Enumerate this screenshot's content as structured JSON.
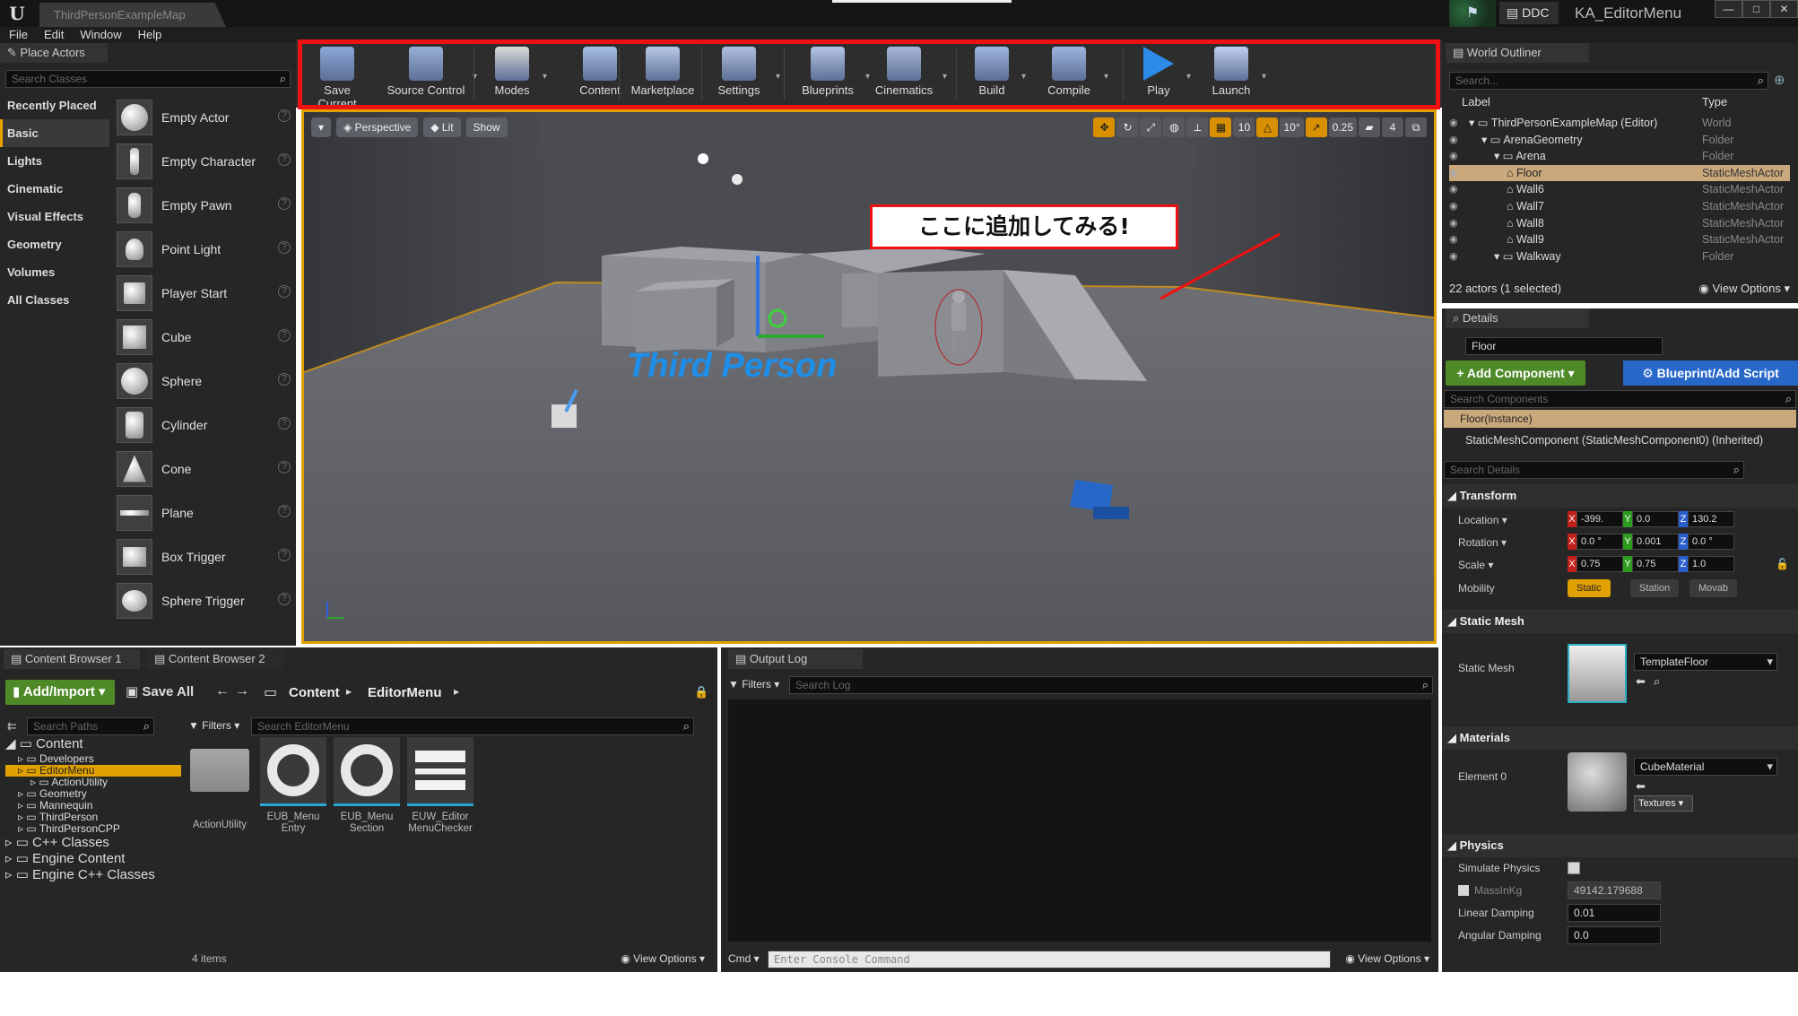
{
  "titlebar": {
    "tab": "ThirdPersonExampleMap",
    "ddc": "DDC",
    "project": "KA_EditorMenu",
    "win_min": "—",
    "win_max": "□",
    "win_close": "✕"
  },
  "menu": [
    "File",
    "Edit",
    "Window",
    "Help"
  ],
  "place_actors": {
    "tab": "Place Actors",
    "search_placeholder": "Search Classes",
    "categories": [
      "Recently Placed",
      "Basic",
      "Lights",
      "Cinematic",
      "Visual Effects",
      "Geometry",
      "Volumes",
      "All Classes"
    ],
    "active_category": "Basic",
    "actors": [
      "Empty Actor",
      "Empty Character",
      "Empty Pawn",
      "Point Light",
      "Player Start",
      "Cube",
      "Sphere",
      "Cylinder",
      "Cone",
      "Plane",
      "Box Trigger",
      "Sphere Trigger"
    ]
  },
  "toolbar": {
    "items": [
      "Save Current",
      "Source Control",
      "Modes",
      "Content",
      "Marketplace",
      "Settings",
      "Blueprints",
      "Cinematics",
      "Build",
      "Compile",
      "Play",
      "Launch"
    ]
  },
  "viewport": {
    "view_mode": "Perspective",
    "lit": "Lit",
    "show": "Show",
    "grid_snap": "10",
    "rot_snap": "10°",
    "scale_snap": "0.25",
    "cam_speed": "4",
    "watermark": "Third Person",
    "callout": "ここに追加してみる!"
  },
  "outliner": {
    "tab": "World Outliner",
    "search_placeholder": "Search...",
    "col_label": "Label",
    "col_type": "Type",
    "rows": [
      {
        "label": "ThirdPersonExampleMap (Editor)",
        "type": "World",
        "indent": 0
      },
      {
        "label": "ArenaGeometry",
        "type": "Folder",
        "indent": 1
      },
      {
        "label": "Arena",
        "type": "Folder",
        "indent": 2
      },
      {
        "label": "Floor",
        "type": "StaticMeshActor",
        "indent": 3,
        "selected": true
      },
      {
        "label": "Wall6",
        "type": "StaticMeshActor",
        "indent": 3
      },
      {
        "label": "Wall7",
        "type": "StaticMeshActor",
        "indent": 3
      },
      {
        "label": "Wall8",
        "type": "StaticMeshActor",
        "indent": 3
      },
      {
        "label": "Wall9",
        "type": "StaticMeshActor",
        "indent": 3
      },
      {
        "label": "Walkway",
        "type": "Folder",
        "indent": 2
      }
    ],
    "footer": "22 actors (1 selected)",
    "view_options": "View Options"
  },
  "details": {
    "tab": "Details",
    "name": "Floor",
    "add_component": "+ Add Component",
    "blueprint_script": "Blueprint/Add Script",
    "search_components": "Search Components",
    "instance": "Floor(Instance)",
    "component": "StaticMeshComponent (StaticMeshComponent0) (Inherited)",
    "search_details": "Search Details",
    "transform": "Transform",
    "location_label": "Location",
    "location": [
      "-399.",
      "0.0",
      "130.2"
    ],
    "rotation_label": "Rotation",
    "rotation": [
      "0.0 °",
      "0.001",
      "0.0 °"
    ],
    "scale_label": "Scale",
    "scale": [
      "0.75",
      "0.75",
      "1.0"
    ],
    "mobility_label": "Mobility",
    "mobility": [
      "Static",
      "Station",
      "Movab"
    ],
    "static_mesh_section": "Static Mesh",
    "static_mesh_label": "Static Mesh",
    "static_mesh_value": "TemplateFloor",
    "materials_section": "Materials",
    "element0_label": "Element 0",
    "material_value": "CubeMaterial",
    "textures": "Textures",
    "physics_section": "Physics",
    "simulate_physics": "Simulate Physics",
    "mass_label": "MassInKg",
    "mass_value": "49142.179688",
    "linear_damping_label": "Linear Damping",
    "linear_damping": "0.01",
    "angular_damping_label": "Angular Damping",
    "angular_damping": "0.0"
  },
  "content_browser": {
    "tab1": "Content Browser 1",
    "tab2": "Content Browser 2",
    "add_import": "Add/Import",
    "save_all": "Save All",
    "path": [
      "Content",
      "EditorMenu"
    ],
    "search_paths": "Search Paths",
    "filters": "Filters",
    "search_assets": "Search EditorMenu",
    "tree": [
      "Content",
      "Developers",
      "EditorMenu",
      "ActionUtility",
      "Geometry",
      "Mannequin",
      "ThirdPerson",
      "ThirdPersonCPP",
      "C++ Classes",
      "Engine Content",
      "Engine C++ Classes"
    ],
    "assets": [
      {
        "name": "ActionUtility",
        "kind": "folder"
      },
      {
        "name": "EUB_Menu Entry",
        "kind": "blueprint"
      },
      {
        "name": "EUB_Menu Section",
        "kind": "blueprint"
      },
      {
        "name": "EUW_Editor MenuChecker",
        "kind": "widget"
      }
    ],
    "count": "4 items",
    "view_options": "View Options"
  },
  "output_log": {
    "tab": "Output Log",
    "filters": "Filters",
    "search_placeholder": "Search Log",
    "cmd": "Cmd",
    "console_placeholder": "Enter Console Command",
    "view_options": "View Options"
  },
  "colors": {
    "accent": "#e0a000",
    "highlight": "#ee1111",
    "green": "#4f8a28",
    "blue": "#2667c8"
  }
}
